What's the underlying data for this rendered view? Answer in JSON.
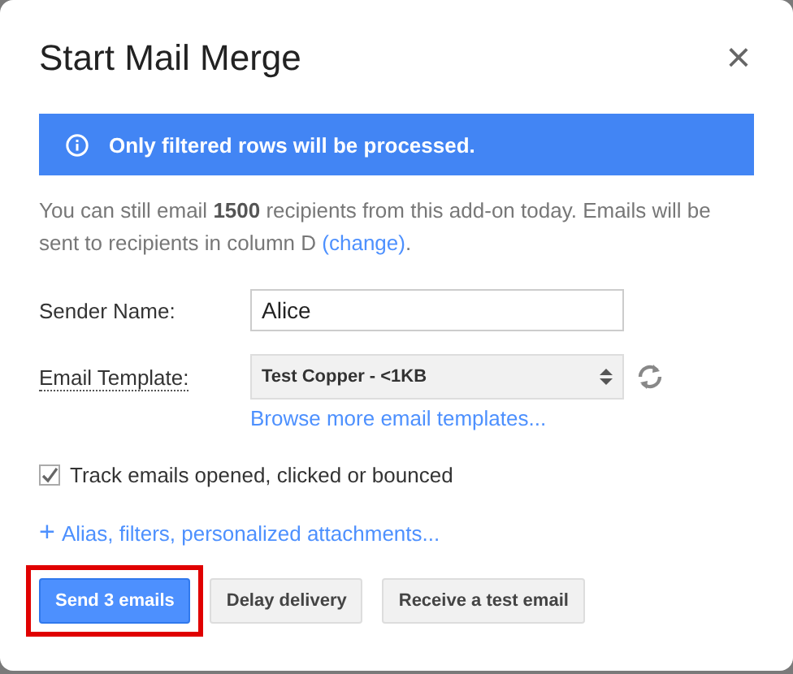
{
  "dialog": {
    "title": "Start Mail Merge",
    "close": "×"
  },
  "banner": {
    "text": "Only filtered rows will be processed."
  },
  "notice": {
    "text": "You can still email **1500** recipients from this add-on today. Emails will be sent to recipients in column D",
    "link": "(change)",
    "end": "."
  },
  "sender": {
    "label": "Sender Name:",
    "value": "Alice"
  },
  "template": {
    "label": "Email Template:",
    "value": "Test Copper - <1KB",
    "browse_link": "Browse more email templates..."
  },
  "track": {
    "label": "Track emails opened, clicked or bounced",
    "checked": true
  },
  "more_link": {
    "icon": "+",
    "text": "Alias, filters, personalized attachments..."
  },
  "buttons": [
    {
      "label": "Send 3 emails",
      "kind": "primary",
      "highlighted": true
    },
    {
      "label": "Delay delivery",
      "kind": "secondary",
      "highlighted": false
    },
    {
      "label": "Receive a test email",
      "kind": "secondary",
      "highlighted": false
    }
  ]
}
